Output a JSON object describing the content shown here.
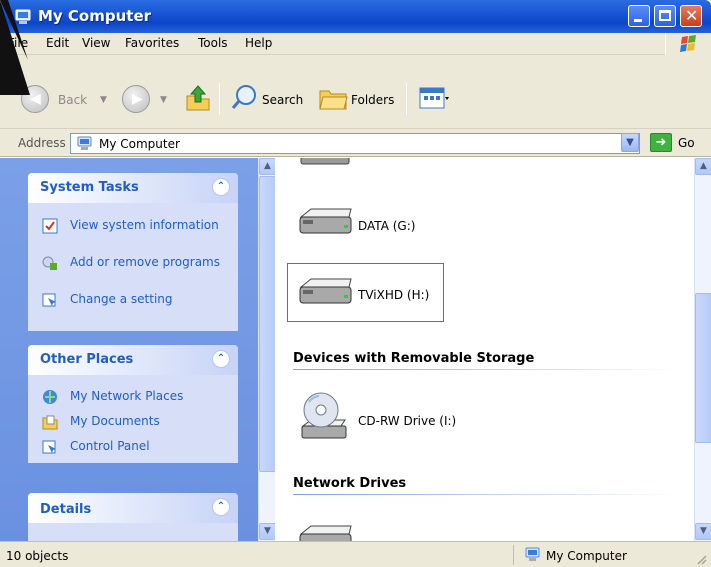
{
  "window": {
    "title": "My Computer"
  },
  "menu": [
    "File",
    "Edit",
    "View",
    "Favorites",
    "Tools",
    "Help"
  ],
  "toolbar": {
    "back": "Back",
    "search": "Search",
    "folders": "Folders"
  },
  "address": {
    "label": "Address",
    "value": "My Computer",
    "go": "Go"
  },
  "sidebar": {
    "system_tasks": {
      "title": "System Tasks",
      "items": [
        "View system information",
        "Add or remove programs",
        "Change a setting"
      ]
    },
    "other_places": {
      "title": "Other Places",
      "items": [
        "My Network Places",
        "My Documents",
        "Control Panel"
      ]
    },
    "details": {
      "title": "Details"
    }
  },
  "content": {
    "drives": [
      {
        "label": "DATA (G:)"
      },
      {
        "label": "TViXHD (H:)",
        "highlighted": true
      }
    ],
    "groups": {
      "removable": "Devices with Removable Storage",
      "network": "Network Drives"
    },
    "removable_drives": [
      {
        "label": "CD-RW Drive (I:)"
      }
    ]
  },
  "status": {
    "left": "10 objects",
    "right": "My Computer"
  },
  "colors": {
    "titlebar": "#0c46c8",
    "highlight_border": "#e04040",
    "task_link": "#215dc6"
  }
}
